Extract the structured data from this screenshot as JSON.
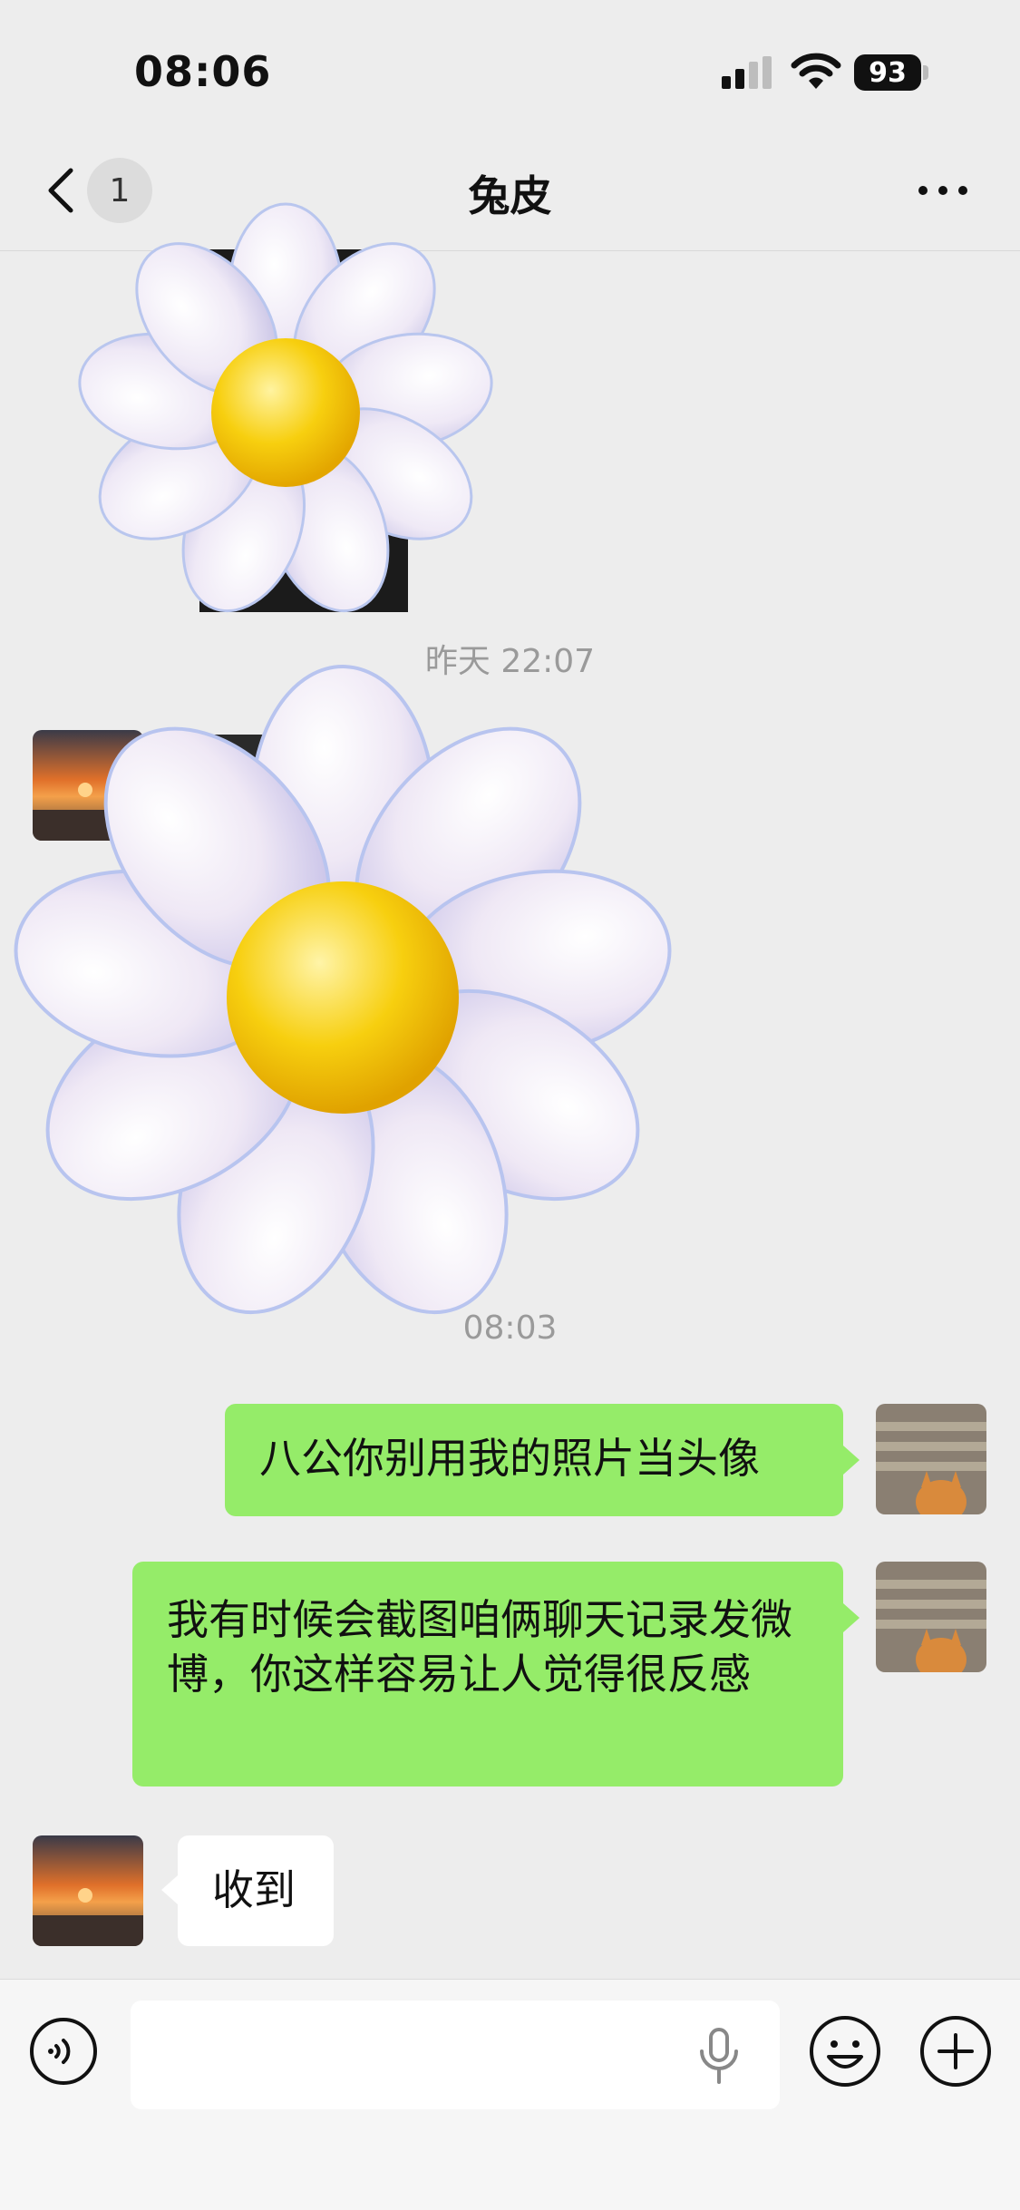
{
  "status_bar": {
    "time": "08:06",
    "battery": "93"
  },
  "nav": {
    "unread_count": "1",
    "title": "兔皮"
  },
  "messages": {
    "timestamp_yesterday": "昨天 22:07",
    "timestamp_today": "08:03",
    "out_1": "八公你别用我的照片当头像",
    "out_2": "我有时候会截图咱俩聊天记录发微博，你这样容易让人觉得很反感",
    "in_1": "收到"
  },
  "colors": {
    "outgoing_bubble": "#95ec69",
    "incoming_bubble": "#ffffff",
    "background": "#ededed"
  },
  "icons": [
    "back-icon",
    "more-icon",
    "voice-icon",
    "mic-icon",
    "emoji-icon",
    "plus-icon"
  ]
}
